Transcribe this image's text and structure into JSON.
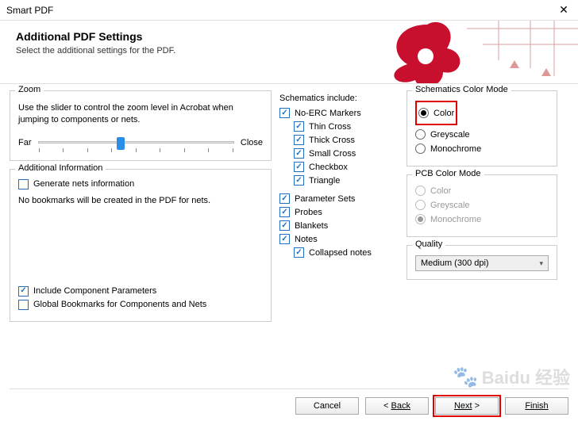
{
  "window": {
    "title": "Smart PDF"
  },
  "header": {
    "title": "Additional PDF Settings",
    "subtitle": "Select the additional settings for the PDF."
  },
  "zoom": {
    "title": "Zoom",
    "text": "Use the slider to control the zoom level in Acrobat when jumping to components or nets.",
    "far": "Far",
    "close": "Close"
  },
  "addinfo": {
    "title": "Additional Information",
    "generate_nets": "Generate nets information",
    "no_bookmarks": "No bookmarks will be created in the PDF for nets."
  },
  "bottom_checks": {
    "include_component_params": "Include Component Parameters",
    "global_bookmarks": "Global Bookmarks for Components and Nets"
  },
  "schematics_include": {
    "title": "Schematics include:",
    "no_erc": "No-ERC Markers",
    "thin_cross": "Thin Cross",
    "thick_cross": "Thick Cross",
    "small_cross": "Small Cross",
    "checkbox": "Checkbox",
    "triangle": "Triangle",
    "parameter_sets": "Parameter Sets",
    "probes": "Probes",
    "blankets": "Blankets",
    "notes": "Notes",
    "collapsed_notes": "Collapsed notes"
  },
  "sch_color": {
    "title": "Schematics Color Mode",
    "color": "Color",
    "greyscale": "Greyscale",
    "monochrome": "Monochrome"
  },
  "pcb_color": {
    "title": "PCB Color Mode",
    "color": "Color",
    "greyscale": "Greyscale",
    "monochrome": "Monochrome"
  },
  "quality": {
    "title": "Quality",
    "value": "Medium (300 dpi)"
  },
  "footer": {
    "cancel": "Cancel",
    "back_prefix": "< ",
    "back": "Back",
    "next": "Next",
    "next_suffix": " >",
    "finish": "Finish"
  },
  "watermark": "Baidu 经验"
}
